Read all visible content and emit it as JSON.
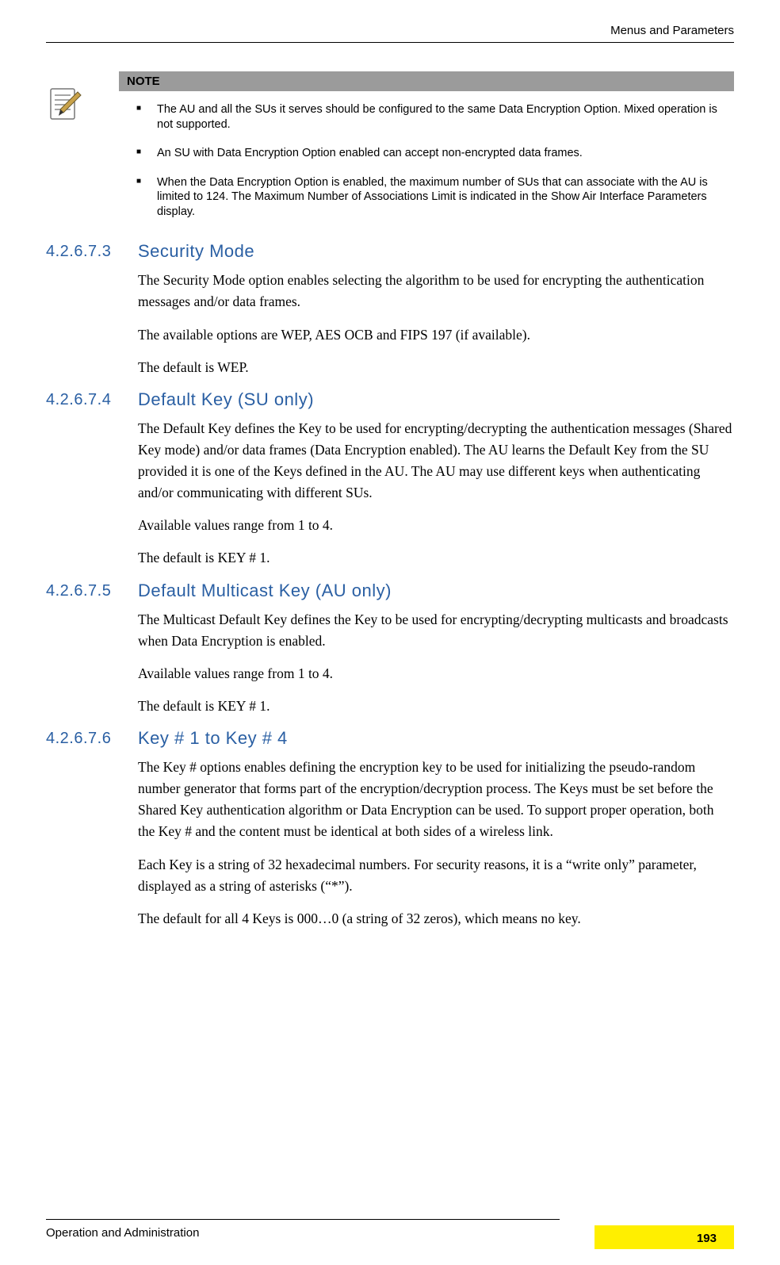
{
  "header": {
    "right": "Menus and Parameters"
  },
  "note": {
    "title": "NOTE",
    "items": [
      "The AU and all the SUs it serves should be configured to the same Data Encryption Option. Mixed operation is not supported.",
      "An SU with Data Encryption Option enabled can accept non-encrypted data frames.",
      "When the Data Encryption Option is enabled, the maximum number of SUs that can associate with the AU is limited to 124. The Maximum Number of Associations Limit is indicated in the Show Air Interface Parameters display."
    ]
  },
  "sections": [
    {
      "num": "4.2.6.7.3",
      "title": "Security Mode",
      "paras": [
        "The Security Mode option enables selecting the algorithm to be used for encrypting the authentication messages and/or data frames.",
        "The available options are WEP, AES OCB and FIPS 197 (if available).",
        "The default is WEP."
      ]
    },
    {
      "num": "4.2.6.7.4",
      "title": "Default Key (SU only)",
      "paras": [
        "The Default Key defines the Key to be used for encrypting/decrypting the authentication messages (Shared Key mode) and/or data frames (Data Encryption enabled). The AU learns the Default Key from the SU provided it is one of the Keys defined in the AU. The AU may use different keys when authenticating and/or communicating with different SUs.",
        "Available values range from 1 to 4.",
        "The default is KEY # 1."
      ]
    },
    {
      "num": "4.2.6.7.5",
      "title": "Default Multicast Key (AU only)",
      "paras": [
        "The Multicast Default Key defines the Key to be used for encrypting/decrypting multicasts and broadcasts when Data Encryption is enabled.",
        "Available values range from 1 to 4.",
        "The default is KEY # 1."
      ]
    },
    {
      "num": "4.2.6.7.6",
      "title": "Key # 1 to Key # 4",
      "paras": [
        "The Key # options enables defining the encryption key to be used for initializing the pseudo-random number generator that forms part of the encryption/decryption process. The Keys must be set before the Shared Key authentication algorithm or Data Encryption can be used. To support proper operation, both the Key # and the content must be identical at both sides of a wireless link.",
        "Each Key is a string of 32 hexadecimal numbers. For security reasons, it is a “write only” parameter, displayed as a string of asterisks (“*”).",
        "The default for all 4 Keys is 000…0 (a string of 32 zeros), which means no key."
      ]
    }
  ],
  "footer": {
    "left": "Operation and Administration",
    "page": "193"
  }
}
